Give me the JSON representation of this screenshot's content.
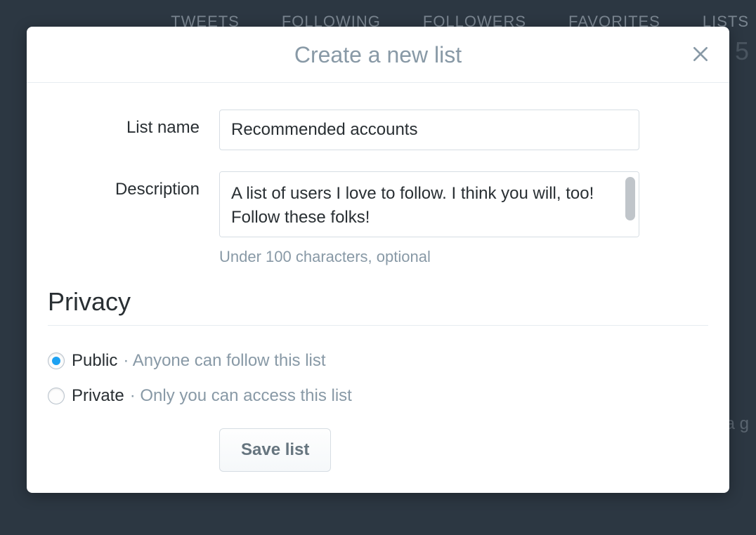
{
  "background": {
    "tabs": [
      "TWEETS",
      "FOLLOWING",
      "FOLLOWERS",
      "FAVORITES",
      "LISTS"
    ],
    "number": "5",
    "snippet": "a g"
  },
  "modal": {
    "title": "Create a new list",
    "fields": {
      "list_name": {
        "label": "List name",
        "value": "Recommended accounts"
      },
      "description": {
        "label": "Description",
        "value": "A list of users I love to follow. I think you will, too! Follow these folks!",
        "hint": "Under 100 characters, optional"
      }
    },
    "privacy": {
      "heading": "Privacy",
      "options": [
        {
          "label": "Public",
          "desc": "Anyone can follow this list",
          "selected": true
        },
        {
          "label": "Private",
          "desc": "Only you can access this list",
          "selected": false
        }
      ]
    },
    "save_label": "Save list"
  }
}
